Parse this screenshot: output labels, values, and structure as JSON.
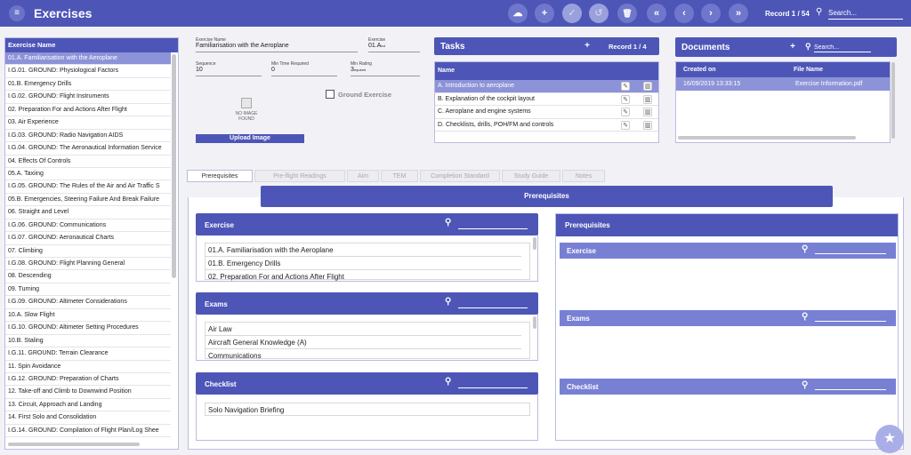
{
  "topbar": {
    "menu_icon": "≡",
    "title": "Exercises",
    "record": "Record 1 / 54",
    "search_placeholder": "Search...",
    "buttons": {
      "upload": "☁",
      "add": "+",
      "save": "✓",
      "undo": "↺",
      "delete": "🗑",
      "first": "«",
      "prev": "‹",
      "next": "›",
      "last": "»"
    }
  },
  "exercise_list": {
    "header": "Exercise Name",
    "items": [
      "01.A. Familiarisation with the Aeroplane",
      "I.G.01. GROUND: Physiological Factors",
      "01.B. Emergency Drills",
      "I.G.02. GROUND: Flight Instruments",
      "02. Preparation For and Actions After Flight",
      "03. Air Experience",
      "I.G.03. GROUND: Radio Navigation AIDS",
      "I.G.04. GROUND: The Aeronautical Information Service",
      "04. Effects Of Controls",
      "05.A. Taxiing",
      "I.G.05. GROUND: The Rules of the Air and Air Traffic S",
      "05.B. Emergencies, Steering Failure And Break Failure",
      "06. Straight and Level",
      "I.G.06. GROUND: Communications",
      "I.G.07. GROUND: Aeronautical Charts",
      "07. Climbing",
      "I.G.08. GROUND: Flight Planning General",
      "08. Descending",
      "09. Turning",
      "I.G.09. GROUND: Altimeter Considerations",
      "10.A. Slow Flight",
      "I.G.10. GROUND: Altimeter Setting Procedures",
      "10.B. Staling",
      "I.G.11. GROUND: Terrain Clearance",
      "11. Spin Avoidance",
      "I.G.12. GROUND: Preparation of Charts",
      "12. Take-off and Climb to Downwind Position",
      "13. Circuit, Approach and Landing",
      "14. First Solo and Consolidation",
      "I.G.14. GROUND: Compilation of Flight Plan/Log Shee"
    ]
  },
  "form": {
    "exercise_name_label": "Exercise Name",
    "exercise_name": "Familiarisation with the Aeroplane",
    "exercise_label": "Exercise",
    "exercise": "01.A",
    "exercise_suffix": "ed",
    "sequence_label": "Sequence",
    "sequence": "10",
    "min_time_label": "Min Time Required",
    "min_time": "0",
    "min_rating_label": "Min Rating",
    "min_rating": "3",
    "min_rating_suffix": "equired",
    "no_image": "NO IMAGE FOUND",
    "upload_image": "Upload Image",
    "ground_exercise": "Ground Exercise"
  },
  "tasks": {
    "title": "Tasks",
    "add": "+",
    "record": "Record 1 / 4",
    "column": "Name",
    "rows": [
      "A. Introduction to aeroplane",
      "B. Explanation of the cockpit layout",
      "C. Aeroplane and engine systems",
      "D. Checklists, drills, POH/FM and controls"
    ],
    "edit_icon": "✎",
    "delete_icon": "▥"
  },
  "documents": {
    "title": "Documents",
    "add": "+",
    "search_placeholder": "Search...",
    "col_created": "Created on",
    "col_file": "File Name",
    "rows": [
      {
        "created": "16/09/2019 13:33:15",
        "file": "Exercise Information.pdf"
      }
    ]
  },
  "tabs": [
    "Prerequisites",
    "Pre-flight Readings",
    "Aim",
    "TEM",
    "Completion Standard",
    "Study Guide",
    "Notes"
  ],
  "prereq_title": "Prerequisites",
  "left_sections": {
    "exercise": {
      "title": "Exercise",
      "items": [
        "01.A. Familiarisation with the Aeroplane",
        "01.B. Emergency Drills",
        "02. Preparation For and Actions After Flight"
      ]
    },
    "exams": {
      "title": "Exams",
      "items": [
        "Air Law",
        "Aircraft General Knowledge (A)",
        "Communications"
      ]
    },
    "checklist": {
      "title": "Checklist",
      "items": [
        "Solo Navigation Briefing"
      ]
    }
  },
  "right_col": {
    "title": "Prerequisites",
    "exercise": "Exercise",
    "exams": "Exams",
    "checklist": "Checklist"
  },
  "search_icon": "⚲",
  "fab_icon": "★"
}
